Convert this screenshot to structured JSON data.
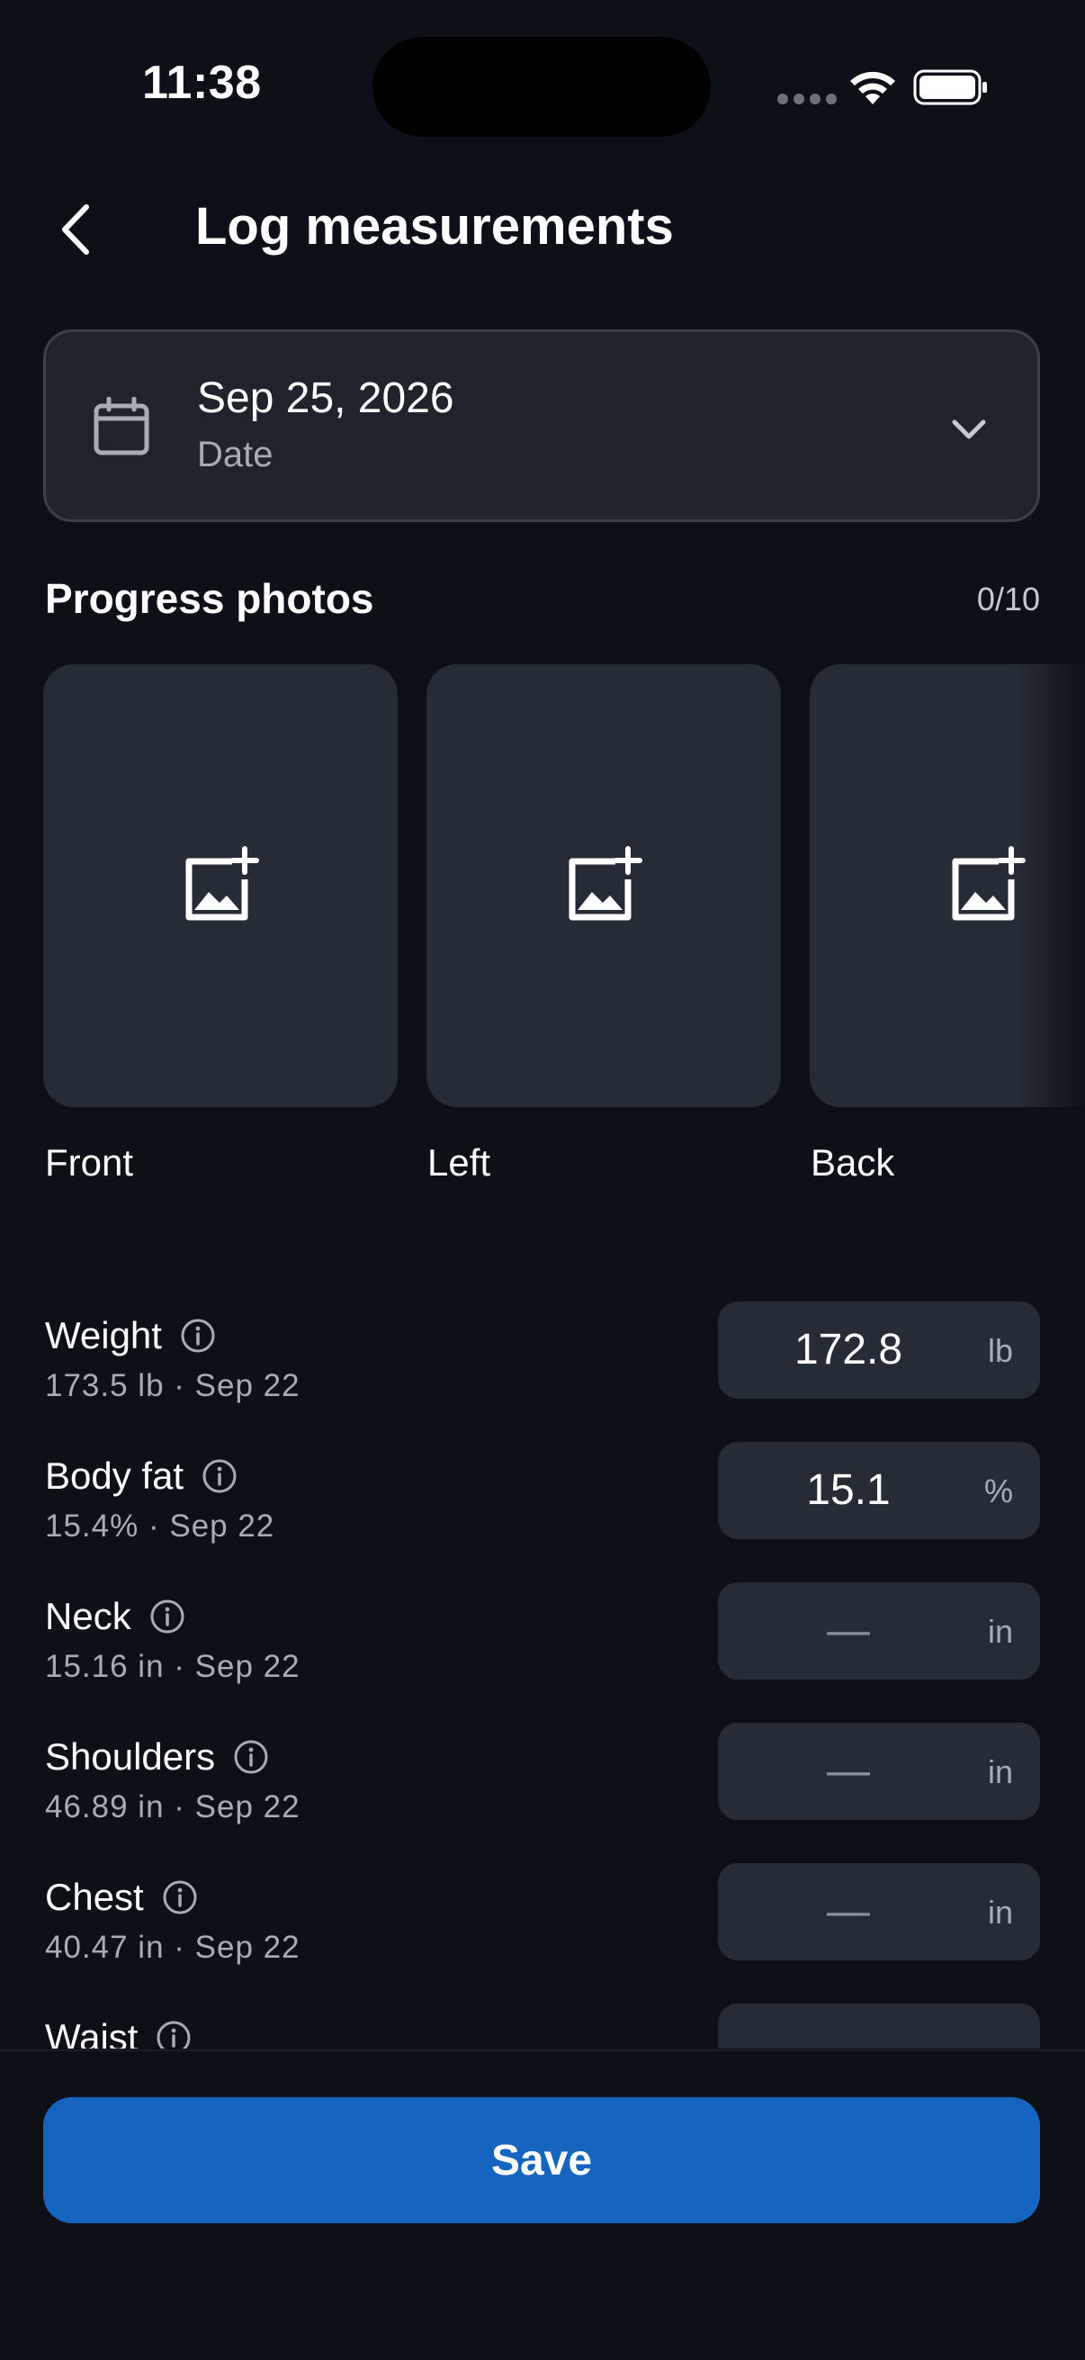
{
  "status_bar": {
    "time": "11:38"
  },
  "header": {
    "title": "Log measurements",
    "back_icon": "chevron-left-icon"
  },
  "date_picker": {
    "value": "Sep 25, 2026",
    "label": "Date",
    "icon": "calendar-icon"
  },
  "photos": {
    "title": "Progress photos",
    "count": "0/10",
    "slots": [
      {
        "label": "Front",
        "icon": "add-photo-icon"
      },
      {
        "label": "Left",
        "icon": "add-photo-icon"
      },
      {
        "label": "Back",
        "icon": "add-photo-icon"
      }
    ]
  },
  "measurements": [
    {
      "name": "Weight",
      "previous": "173.5 lb · Sep 22",
      "value": "172.8",
      "unit": "lb"
    },
    {
      "name": "Body fat",
      "previous": "15.4% · Sep 22",
      "value": "15.1",
      "unit": "%"
    },
    {
      "name": "Neck",
      "previous": "15.16 in · Sep 22",
      "value": "—",
      "unit": "in"
    },
    {
      "name": "Shoulders",
      "previous": "46.89 in · Sep 22",
      "value": "—",
      "unit": "in"
    },
    {
      "name": "Chest",
      "previous": "40.47 in · Sep 22",
      "value": "—",
      "unit": "in"
    },
    {
      "name": "Waist",
      "previous": "",
      "value": "",
      "unit": ""
    }
  ],
  "actions": {
    "save_label": "Save"
  },
  "colors": {
    "accent": "#1565c0",
    "background": "#0d1117",
    "surface": "#262c36"
  }
}
